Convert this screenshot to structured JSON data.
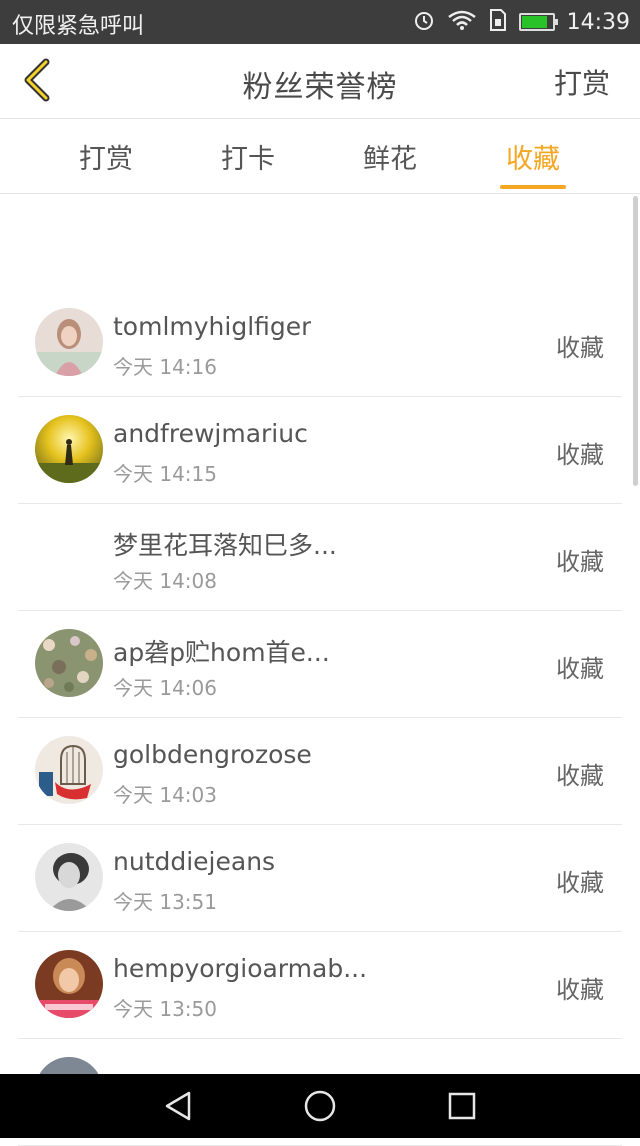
{
  "status_bar": {
    "carrier_text": "仅限紧急呼叫",
    "time": "14:39",
    "icons": [
      "alarm-icon",
      "wifi-icon",
      "sim-icon",
      "battery-icon"
    ],
    "battery_level": 0.85
  },
  "header": {
    "back_icon": "chevron-left-icon",
    "title": "粉丝荣誉榜",
    "action_label": "打赏"
  },
  "tabs": [
    {
      "label": "打赏",
      "active": false
    },
    {
      "label": "打卡",
      "active": false
    },
    {
      "label": "鲜花",
      "active": false
    },
    {
      "label": "收藏",
      "active": true
    }
  ],
  "colors": {
    "accent": "#f5a623",
    "status_bar_bg": "#3d3d3d",
    "nav_bar_bg": "#000000"
  },
  "list": [
    {
      "name": "tomlmyhiglfiger",
      "time": "今天 14:16",
      "action": "收藏",
      "avatar": "avatar-girl-pink"
    },
    {
      "name": "andfrewjmariuc",
      "time": "今天 14:15",
      "action": "收藏",
      "avatar": "avatar-sunset"
    },
    {
      "name": "梦里花耳落知巳多...",
      "time": "今天 14:08",
      "action": "收藏",
      "avatar": "none"
    },
    {
      "name": "ap砻p贮hom首e...",
      "time": "今天 14:06",
      "action": "收藏",
      "avatar": "avatar-flowers"
    },
    {
      "name": "golbdengrozose",
      "time": "今天 14:03",
      "action": "收藏",
      "avatar": "avatar-birdcage"
    },
    {
      "name": "nutddiejeans",
      "time": "今天 13:51",
      "action": "收藏",
      "avatar": "avatar-bw-portrait"
    },
    {
      "name": "hempyorgioarmab...",
      "time": "今天 13:50",
      "action": "收藏",
      "avatar": "avatar-portrait-warm"
    }
  ],
  "nav_bar": {
    "icons": [
      "back-triangle-icon",
      "home-circle-icon",
      "recents-square-icon"
    ]
  }
}
